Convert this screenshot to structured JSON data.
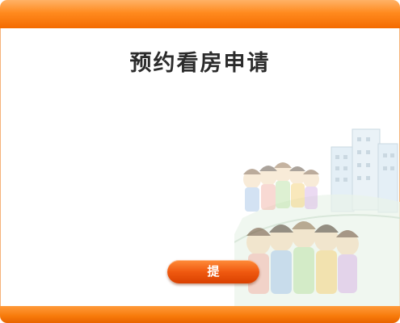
{
  "page": {
    "title": "预约看房申请"
  },
  "form": {
    "submit_label": "提 交"
  },
  "colors": {
    "accent": "#f77a0a",
    "button": "#e8500a",
    "title": "#2b2b2b"
  }
}
